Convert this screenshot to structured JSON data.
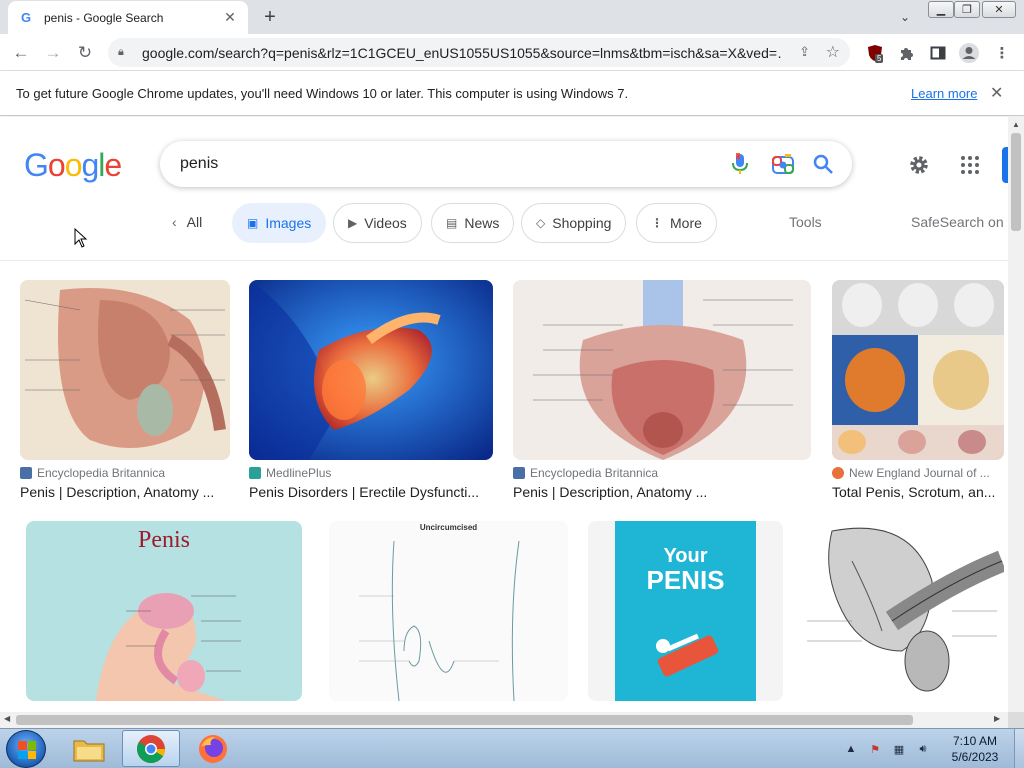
{
  "browser": {
    "tab_title": "penis - Google Search",
    "tab_favicon": "G",
    "url": "google.com/search?q=penis&rlz=1C1GCEU_enUS1055US1055&source=lnms&tbm=isch&sa=X&ved=…",
    "extension_badge": "5"
  },
  "infobar": {
    "message": "To get future Google Chrome updates, you'll need Windows 10 or later. This computer is using Windows 7.",
    "learn_more": "Learn more"
  },
  "search": {
    "logo": "Google",
    "query": "penis"
  },
  "chips": {
    "all": "All",
    "images": "Images",
    "videos": "Videos",
    "news": "News",
    "shopping": "Shopping",
    "more": "More",
    "tools": "Tools",
    "safesearch": "SafeSearch on"
  },
  "results": [
    {
      "source": "Encyclopedia Britannica",
      "caption": "Penis | Description, Anatomy ...",
      "source_color": "#4a6fa5"
    },
    {
      "source": "MedlinePlus",
      "caption": "Penis Disorders | Erectile Dysfuncti...",
      "source_color": "#2aa198"
    },
    {
      "source": "Encyclopedia Britannica",
      "caption": "Penis | Description, Anatomy ...",
      "source_color": "#4a6fa5"
    },
    {
      "source": "New England Journal of ...",
      "caption": "Total Penis, Scrotum, an...",
      "source_color": "#e8703a"
    }
  ],
  "row2": {
    "img1_title": "Penis",
    "img2_title": "Uncircumcised",
    "img3_title_line1": "Your",
    "img3_title_line2": "PENIS"
  },
  "taskbar": {
    "time": "7:10 AM",
    "date": "5/6/2023"
  },
  "colors": {
    "accent": "#1a73e8",
    "chip_active_bg": "#e8f0fe"
  }
}
